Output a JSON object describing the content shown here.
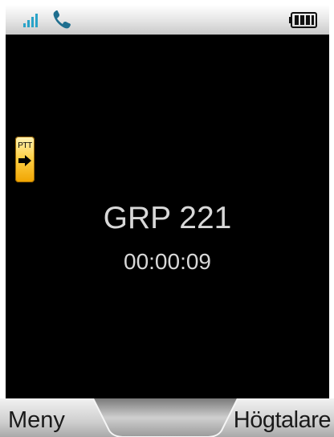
{
  "status_bar": {
    "signal_icon": "signal-bars-icon",
    "call_icon": "phone-handset-icon",
    "battery_icon": "battery-full-icon",
    "accent_color": "#2aa3c8"
  },
  "ptt_indicator": {
    "label": "PTT",
    "color": "#ffc820"
  },
  "call": {
    "group_name": "GRP 221",
    "duration": "00:00:09"
  },
  "softkeys": {
    "left_label": "Meny",
    "right_label": "Högtalare"
  }
}
